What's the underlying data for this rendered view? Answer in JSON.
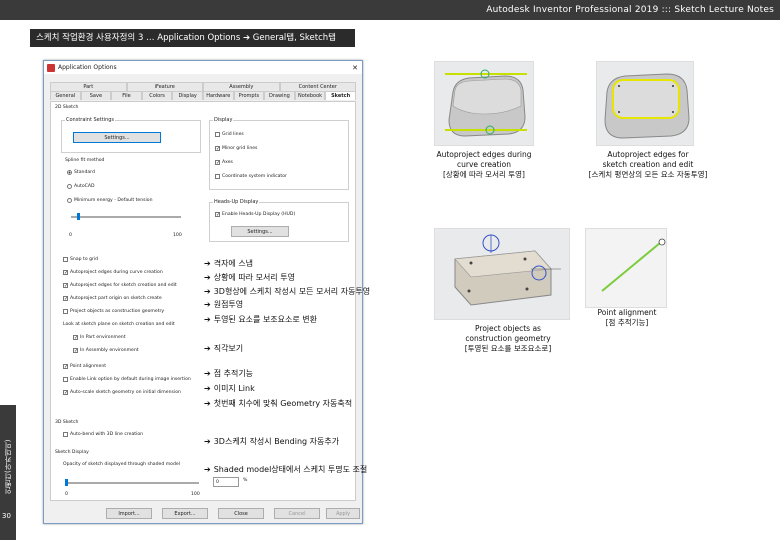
{
  "header": {
    "title": "Autodesk Inventor Professional 2019 ::: Sketch Lecture Notes"
  },
  "section": {
    "title": "스케치 작업환경 사용자정의 3 … Application Options ➔ General탭, Sketch탭"
  },
  "sidebar": {
    "label": "인벤터(아카데미)",
    "page": "30"
  },
  "dialog": {
    "title": "Application Options",
    "close": "✕",
    "tabs_row1": [
      "Part",
      "iFeature",
      "Assembly",
      "Content Center"
    ],
    "tabs_row2": [
      "General",
      "Save",
      "File",
      "Colors",
      "Display",
      "Hardware",
      "Prompts",
      "Drawing",
      "Notebook",
      "Sketch"
    ],
    "active_tab": "Sketch",
    "section_2d": "2D Sketch",
    "constraint_group": "Constraint Settings",
    "settings_btn": "Settings...",
    "spline_label": "Spline fit method",
    "spline_options": [
      "Standard",
      "AutoCAD",
      "Minimum energy - Default tension"
    ],
    "slider_min": "0",
    "slider_max": "100",
    "display_group": "Display",
    "display_items": [
      {
        "label": "Grid lines",
        "checked": ""
      },
      {
        "label": "Minor grid lines",
        "checked": "✓"
      },
      {
        "label": "Axes",
        "checked": "✓"
      },
      {
        "label": "Coordinate system indicator",
        "checked": ""
      }
    ],
    "hud_group": "Heads-Up Display",
    "hud_enable": "Enable Heads-Up Display (HUD)",
    "hud_settings": "Settings...",
    "options": [
      {
        "label": "Snap to grid",
        "checked": ""
      },
      {
        "label": "Autoproject edges during curve creation",
        "checked": "✓"
      },
      {
        "label": "Autoproject edges for sketch creation and edit",
        "checked": "✓"
      },
      {
        "label": "Autoproject part origin on sketch create",
        "checked": "✓"
      },
      {
        "label": "Project objects as construction geometry",
        "checked": ""
      }
    ],
    "look_at_label": "Look at sketch plane on sketch creation and edit",
    "look_at_items": [
      {
        "label": "In Part environment",
        "checked": "✓"
      },
      {
        "label": "In Assembly environment",
        "checked": "✓"
      }
    ],
    "options2": [
      {
        "label": "Point alignment",
        "checked": "✓"
      },
      {
        "label": "Enable Link option by default during image insertion",
        "checked": ""
      },
      {
        "label": "Auto-scale sketch geometry on initial dimension",
        "checked": "✓"
      }
    ],
    "section_3d": "3D Sketch",
    "auto_bend": "Auto-bend with 3D line creation",
    "section_shaded": "Sketch Display",
    "opacity_label": "Opacity of sketch displayed through shaded model",
    "opacity_min": "0",
    "opacity_max": "100",
    "opacity_value": "0",
    "opacity_unit": "%",
    "buttons": {
      "import": "Import...",
      "export": "Export...",
      "close": "Close",
      "cancel": "Cancel",
      "apply": "Apply"
    }
  },
  "annotations": [
    "격자에 스냅",
    "상황에 따라 모서리 투영",
    "3D형상에 스케치 작성시 모든 모서리 자동투영",
    "원점투영",
    "투영된 요소를 보조요소로 변환",
    "직각보기",
    "점 추적기능",
    "이미지 Link",
    "첫번째 치수에 맞춰 Geometry 자동축적",
    "3D스케치 작성시 Bending 자동추가",
    "Shaded model상태에서 스케치 투명도 조절"
  ],
  "captions": {
    "c1": [
      "Autoproject edges during",
      "curve creation",
      "[상황에 따라 모서리 투영]"
    ],
    "c2": [
      "Autoproject edges for",
      "sketch creation and edit",
      "[스케치 평면상의 모든 요소 자동투영]"
    ],
    "c3": [
      "Project objects as",
      "construction geometry",
      "[투영된 요소를 보조요소로]"
    ],
    "c4": [
      "Point alignment",
      "[점 추적기능]"
    ]
  },
  "colors": {
    "accent": "#0078d7",
    "dark": "#3a3a3a"
  }
}
